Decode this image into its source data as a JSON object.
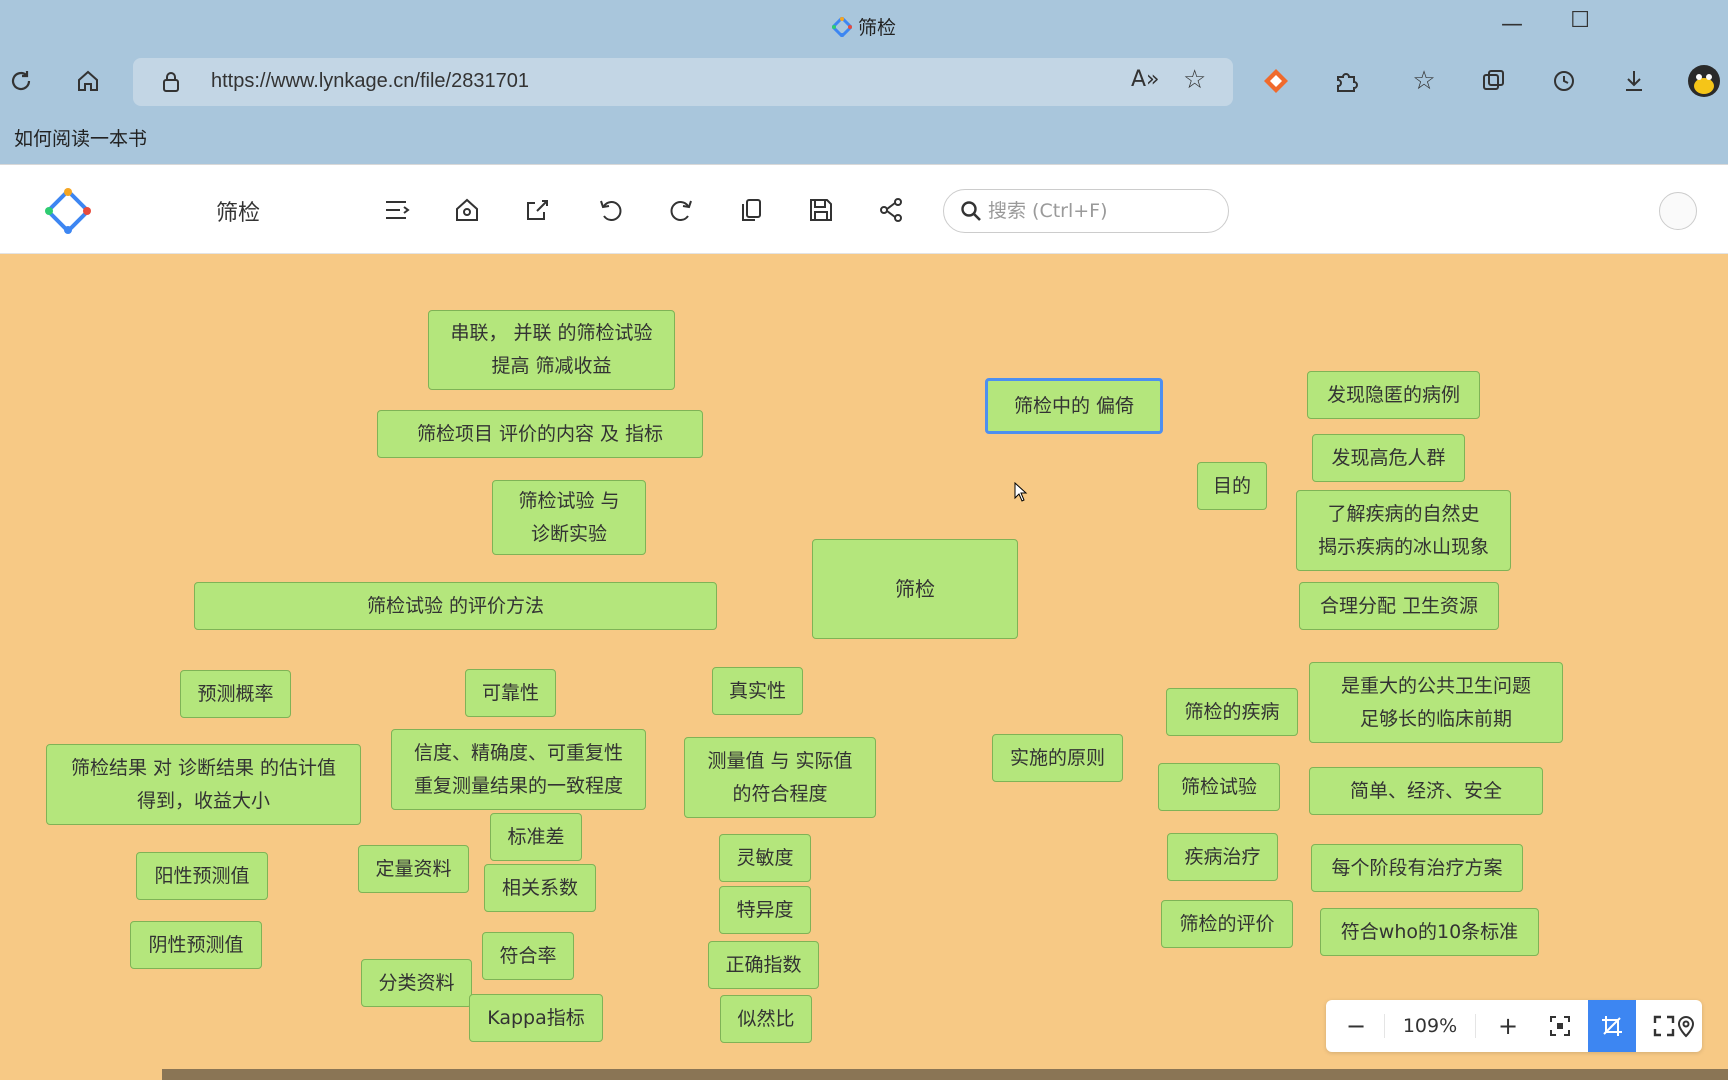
{
  "browser": {
    "window_title": "筛检",
    "url": "https://www.lynkage.cn/file/2831701",
    "bookmark": "如何阅读一本书"
  },
  "app": {
    "doc_title": "筛检",
    "search_placeholder": "搜索 (Ctrl+F)"
  },
  "zoom": {
    "level": "109%"
  },
  "nodes": {
    "center": "筛检",
    "bias": "筛检中的 偏倚",
    "series_parallel": "串联， 并联 的筛检试验\n提高 筛减收益",
    "eval_content": "筛检项目 评价的内容 及 指标",
    "test_vs_diag": "筛检试验  与\n诊断实验",
    "eval_method": "筛检试验 的评价方法",
    "purpose": "目的",
    "find_hidden": "发现隐匿的病例",
    "find_high_risk": "发现高危人群",
    "natural_history": "了解疾病的自然史\n揭示疾病的冰山现象",
    "allocate": "合理分配 卫生资源",
    "pred_prob": "预测概率",
    "reliability": "可靠性",
    "validity": "真实性",
    "pred_desc": "筛检结果 对 诊断结果 的估计值\n得到，收益大小",
    "reliability_desc": "信度、精确度、可重复性\n重复测量结果的一致程度",
    "validity_desc": "测量值 与 实际值\n的符合程度",
    "principles": "实施的原则",
    "disease": "筛检的疾病",
    "disease_desc": "是重大的公共卫生问题\n足够长的临床前期",
    "test": "筛检试验",
    "test_desc": "简单、经济、安全",
    "treatment": "疾病治疗",
    "treatment_desc": "每个阶段有治疗方案",
    "evaluation": "筛检的评价",
    "evaluation_desc": "符合who的10条标准",
    "ppv": "阳性预测值",
    "npv": "阴性预测值",
    "quantitative": "定量资料",
    "std_dev": "标准差",
    "correlation": "相关系数",
    "categorical": "分类资料",
    "agreement": "符合率",
    "kappa": "Kappa指标",
    "sensitivity": "灵敏度",
    "specificity": "特异度",
    "youden": "正确指数",
    "likelihood": "似然比"
  }
}
